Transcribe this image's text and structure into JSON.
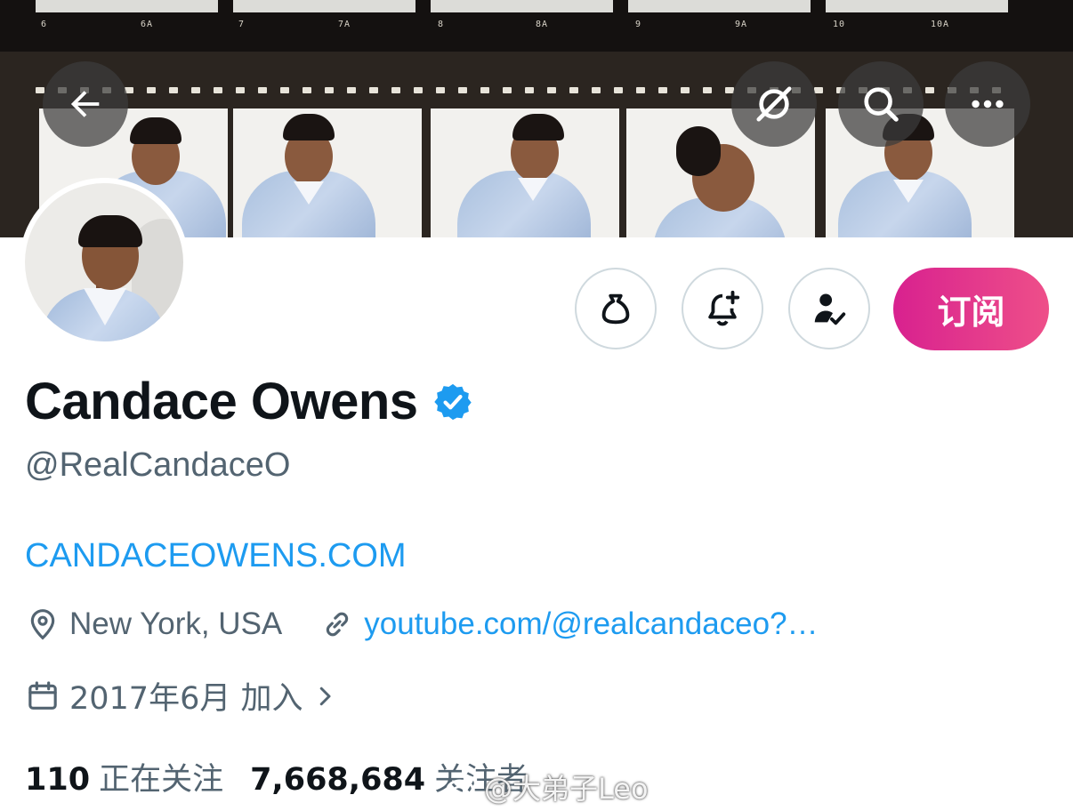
{
  "banner": {
    "frame_numbers": [
      "6",
      "6A",
      "7",
      "7A",
      "8",
      "8A",
      "9",
      "9A",
      "10",
      "10A"
    ],
    "buttons": {
      "back_icon": "arrow-left-icon",
      "grok_icon": "grok-icon",
      "search_icon": "search-icon",
      "more_icon": "more-horizontal-icon"
    }
  },
  "actions": {
    "tip_icon": "money-bag-icon",
    "notify_icon": "bell-plus-icon",
    "follows_you_icon": "user-check-icon",
    "subscribe_label": "订阅",
    "subscribe_colors": [
      "#d8218f",
      "#ee4f89"
    ]
  },
  "profile": {
    "name": "Candace Owens",
    "verified_badge": "verified-badge-icon",
    "handle": "@RealCandaceO",
    "website": "CANDACEOWENS.COM",
    "location": "New York, USA",
    "link": "youtube.com/@realcandaceo?…",
    "joined": "2017年6月 加入",
    "following_count": "110",
    "following_label": "正在关注",
    "followers_count": "7,668,684",
    "followers_label": "关注者"
  },
  "watermark": {
    "text": "@大弟子Leo"
  },
  "colors": {
    "link": "#1d9bf0",
    "secondary_text": "#536471",
    "primary_text": "#0f1419",
    "verified": "#1d9bf0"
  }
}
